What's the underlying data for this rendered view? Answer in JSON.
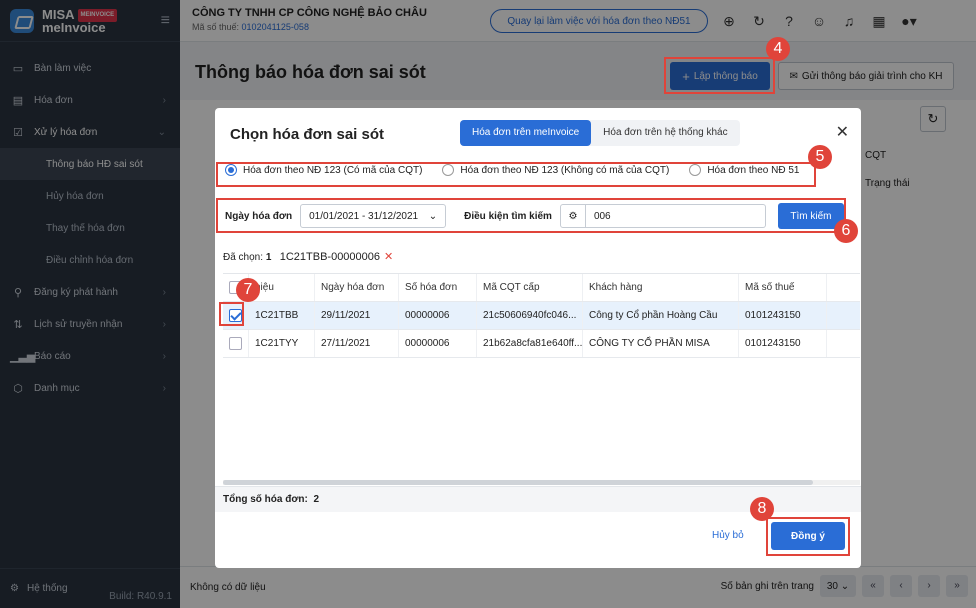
{
  "sidebar": {
    "logo_top": "MISA",
    "logo_badge": "MEINVOICE",
    "logo_bottom": "meInvoice",
    "items": [
      {
        "label": "Bàn làm việc"
      },
      {
        "label": "Hóa đơn"
      },
      {
        "label": "Xử lý hóa đơn"
      },
      {
        "label": "Đăng ký phát hành"
      },
      {
        "label": "Lịch sử truyền nhận"
      },
      {
        "label": "Báo cáo"
      },
      {
        "label": "Danh mục"
      }
    ],
    "subitems": [
      {
        "label": "Thông báo HĐ sai sót"
      },
      {
        "label": "Hủy hóa đơn"
      },
      {
        "label": "Thay thế hóa đơn"
      },
      {
        "label": "Điều chỉnh hóa đơn"
      }
    ],
    "system": "Hệ thống",
    "build": "Build: R40.9.1"
  },
  "topbar": {
    "company": "CÔNG TY TNHH CP CÔNG NGHỆ BẢO CHÂU",
    "tax_label": "Mã số thuế:",
    "tax_code": "0102041125-058",
    "back_button": "Quay lại làm việc với hóa đơn theo NĐ51"
  },
  "page": {
    "title": "Thông báo hóa đơn sai sót",
    "create_button": "Lập thông báo",
    "send_button": "Gửi thông báo giải trình cho KH",
    "col_cqt": "CQT",
    "col_status": "Trạng thái"
  },
  "footer": {
    "no_data": "Không có dữ liệu",
    "page_size_label": "Số bản ghi trên trang",
    "page_size": "30"
  },
  "modal": {
    "title": "Chọn hóa đơn sai sót",
    "tabs": [
      "Hóa đơn trên meInvoice",
      "Hóa đơn trên hệ thống khác"
    ],
    "radios": [
      "Hóa đơn theo NĐ 123 (Có mã của CQT)",
      "Hóa đơn theo NĐ 123 (Không có mã của CQT)",
      "Hóa đơn theo NĐ 51"
    ],
    "date_label": "Ngày hóa đơn",
    "date_value": "01/01/2021 - 31/12/2021",
    "condition_label": "Điều kiện tìm kiếm",
    "search_value": "006",
    "search_button": "Tìm kiếm",
    "selected_label": "Đã chọn:",
    "selected_count": "1",
    "selected_item": "1C21TBB-00000006",
    "columns": [
      "hiệu",
      "Ngày hóa đơn",
      "Số hóa đơn",
      "Mã CQT cấp",
      "Khách hàng",
      "Mã số thuế"
    ],
    "rows": [
      {
        "symbol": "1C21TBB",
        "date": "29/11/2021",
        "number": "00000006",
        "cqt": "21c50606940fc046...",
        "customer": "Công ty Cổ phần Hoàng Cầu",
        "tax": "0101243150"
      },
      {
        "symbol": "1C21TYY",
        "date": "27/11/2021",
        "number": "00000006",
        "cqt": "21b62a8cfa81e640ff...",
        "customer": "CÔNG TY CỔ PHẦN MISA",
        "tax": "0101243150"
      }
    ],
    "total_label": "Tổng số hóa đơn:",
    "total_value": "2",
    "cancel": "Hủy bỏ",
    "agree": "Đồng ý"
  },
  "steps": [
    "4",
    "5",
    "6",
    "7",
    "8"
  ]
}
